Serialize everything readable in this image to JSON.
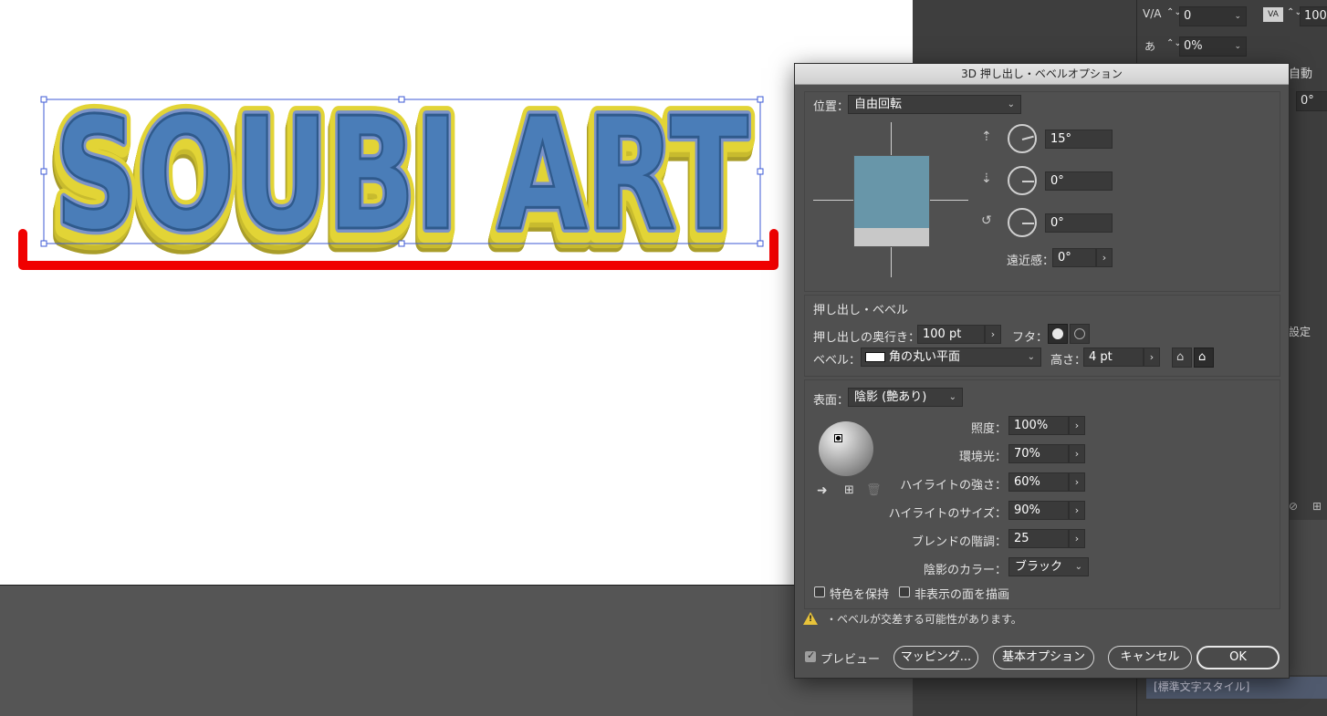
{
  "artwork": {
    "text": "SOUBI ART",
    "colors": {
      "face": "#4a7db8",
      "extrude": "#e2d436",
      "outline": "#7b93c9",
      "bracket": "#f00000"
    }
  },
  "right_panel": {
    "tracking_value": "0",
    "scale_value": "100",
    "tsume_value": "0%",
    "auto_label": "自動",
    "degree_value": "0°",
    "setting_label": "設定",
    "style_item": "[標準文字スタイル]"
  },
  "dialog": {
    "title": "3D 押し出し・ベベルオプション",
    "position": {
      "label": "位置：",
      "value": "自由回転",
      "x_angle": "15°",
      "y_angle": "0°",
      "z_angle": "0°",
      "perspective_label": "遠近感：",
      "perspective_value": "0°"
    },
    "extrude": {
      "section_label": "押し出し・ベベル",
      "depth_label": "押し出しの奥行き：",
      "depth_value": "100 pt",
      "cap_label": "フタ：",
      "bevel_label": "ベベル：",
      "bevel_value": "角の丸い平面",
      "height_label": "高さ：",
      "height_value": "4 pt"
    },
    "surface": {
      "label": "表面：",
      "value": "陰影 (艶あり)",
      "light_intensity_label": "照度：",
      "light_intensity_value": "100%",
      "ambient_label": "環境光：",
      "ambient_value": "70%",
      "highlight_intensity_label": "ハイライトの強さ：",
      "highlight_intensity_value": "60%",
      "highlight_size_label": "ハイライトのサイズ：",
      "highlight_size_value": "90%",
      "blend_steps_label": "ブレンドの階調：",
      "blend_steps_value": "25",
      "shading_color_label": "陰影のカラー：",
      "shading_color_value": "ブラック",
      "preserve_spot_label": "特色を保持",
      "preserve_spot_checked": false,
      "draw_hidden_label": "非表示の面を描画",
      "draw_hidden_checked": false
    },
    "warning": "・ベベルが交差する可能性があります。",
    "buttons": {
      "preview_label": "プレビュー",
      "preview_checked": true,
      "mapping": "マッピング...",
      "basic_options": "基本オプション",
      "cancel": "キャンセル",
      "ok": "OK"
    },
    "cube_colors": {
      "front": "#6896a9",
      "side": "#c8c8c8"
    }
  }
}
